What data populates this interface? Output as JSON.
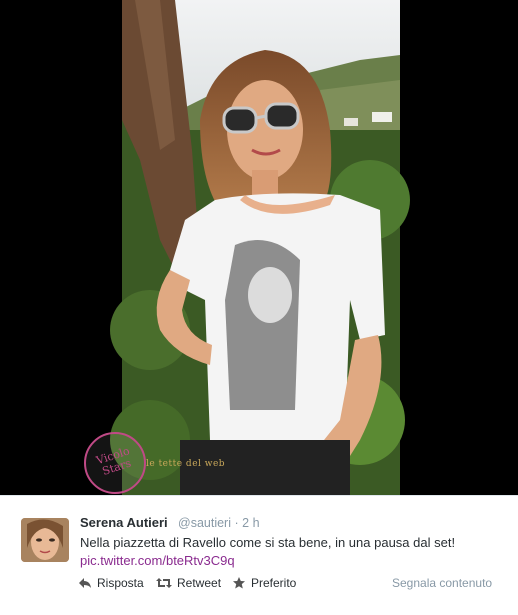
{
  "tweet": {
    "author_name": "Serena Autieri",
    "author_handle": "@sautieri",
    "separator": "·",
    "time": "2 h",
    "text": "Nella piazzetta di Ravello come si sta bene, in una pausa dal set!",
    "link": "pic.twitter.com/bteRtv3C9q"
  },
  "actions": {
    "reply": "Risposta",
    "retweet": "Retweet",
    "favorite": "Preferito",
    "report": "Segnala contenuto"
  },
  "photo": {
    "watermark_logo": "Vicolo Stars",
    "watermark_site": "le tette del web"
  },
  "colors": {
    "link": "#8a2b8f",
    "muted": "#8899a6",
    "text": "#292f33"
  }
}
